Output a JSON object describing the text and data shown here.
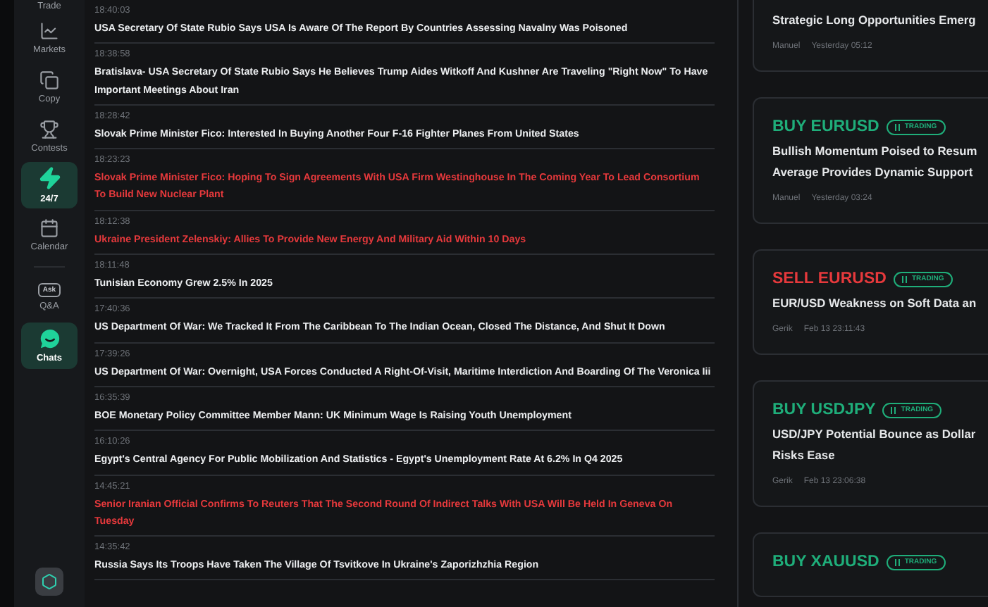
{
  "sidebar": {
    "items": [
      {
        "label": "Trade",
        "selected": false
      },
      {
        "label": "Markets",
        "selected": false
      },
      {
        "label": "Copy",
        "selected": false
      },
      {
        "label": "Contests",
        "selected": false
      },
      {
        "label": "24/7",
        "selected": true
      },
      {
        "label": "Calendar",
        "selected": false
      },
      {
        "label": "Q&A",
        "selected": false,
        "icon_text": "Ask"
      },
      {
        "label": "Chats",
        "selected": true
      }
    ]
  },
  "news": [
    {
      "time": "18:40:03",
      "title": "USA Secretary Of State Rubio Says USA Is Aware Of The Report By Countries Assessing Navalny Was Poisoned",
      "important": false
    },
    {
      "time": "18:38:58",
      "title": "Bratislava- USA Secretary Of State Rubio Says He Believes Trump Aides Witkoff And Kushner Are Traveling \"Right Now\" To Have Important Meetings About Iran",
      "important": false
    },
    {
      "time": "18:28:42",
      "title": "Slovak Prime Minister Fico: Interested In Buying Another Four F-16 Fighter Planes From United States",
      "important": false
    },
    {
      "time": "18:23:23",
      "title": "Slovak Prime Minister Fico: Hoping To Sign Agreements With USA Firm Westinghouse In The Coming Year To Lead Consortium To Build New Nuclear Plant",
      "important": true
    },
    {
      "time": "18:12:38",
      "title": "Ukraine President Zelenskiy: Allies To Provide New Energy And Military Aid Within 10 Days",
      "important": true
    },
    {
      "time": "18:11:48",
      "title": "Tunisian Economy Grew 2.5% In 2025",
      "important": false
    },
    {
      "time": "17:40:36",
      "title": "US Department Of War: We Tracked It From The Caribbean To The Indian Ocean, Closed The Distance, And Shut It Down",
      "important": false
    },
    {
      "time": "17:39:26",
      "title": "US Department Of War: Overnight, USA Forces Conducted A Right-Of-Visit, Maritime Interdiction And Boarding Of The Veronica Iii",
      "important": false
    },
    {
      "time": "16:35:39",
      "title": "BOE Monetary Policy Committee Member Mann: UK Minimum Wage Is Raising Youth Unemployment",
      "important": false
    },
    {
      "time": "16:10:26",
      "title": "Egypt's Central Agency For Public Mobilization And Statistics - Egypt's Unemployment Rate At 6.2% In Q4 2025",
      "important": false
    },
    {
      "time": "14:45:21",
      "title": "Senior Iranian Official Confirms To Reuters That The Second Round Of Indirect Talks With USA Will Be Held In Geneva On Tuesday",
      "important": true
    },
    {
      "time": "14:35:42",
      "title": "Russia Says Its Troops Have Taken The Village Of Tsvitkove In Ukraine's Zaporizhzhia Region",
      "important": false
    }
  ],
  "ideas": [
    {
      "title_lines": [
        "Strategic Long Opportunities Emerg"
      ],
      "author": "Manuel",
      "date": "Yesterday 05:12"
    },
    {
      "kind": "buy",
      "signal": "BUY EURUSD",
      "status": "TRADING",
      "title_lines": [
        "Bullish Momentum Poised to Resum",
        "Average Provides Dynamic Support"
      ],
      "author": "Manuel",
      "date": "Yesterday 03:24"
    },
    {
      "kind": "sell",
      "signal": "SELL EURUSD",
      "status": "TRADING",
      "title_lines": [
        "EUR/USD Weakness on Soft Data an"
      ],
      "author": "Gerik",
      "date": "Feb 13 23:11:43"
    },
    {
      "kind": "buy",
      "signal": "BUY USDJPY",
      "status": "TRADING",
      "title_lines": [
        "USD/JPY Potential Bounce as Dollar",
        "Risks Ease"
      ],
      "author": "Gerik",
      "date": "Feb 13 23:06:38"
    },
    {
      "kind": "buy",
      "signal": "BUY XAUUSD",
      "status": "TRADING"
    }
  ]
}
